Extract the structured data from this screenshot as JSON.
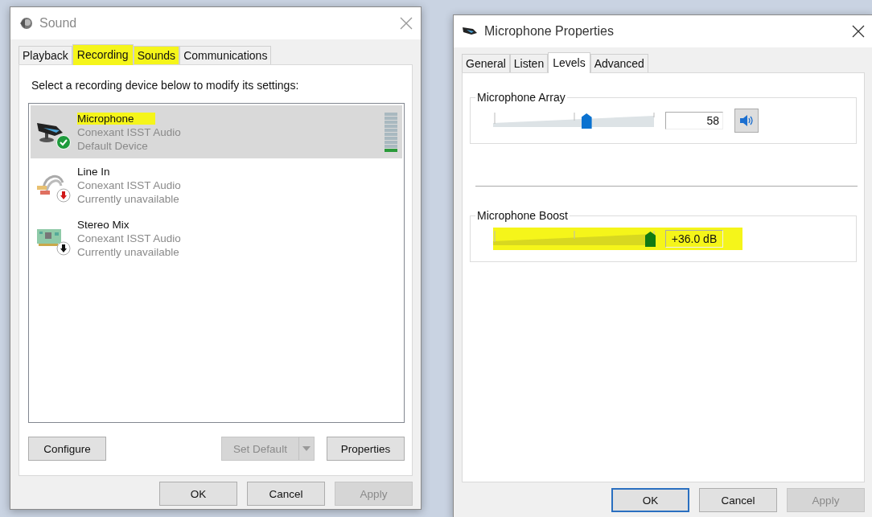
{
  "sound_window": {
    "title": "Sound",
    "tabs": [
      {
        "label": "Playback",
        "selected": false,
        "highlighted": false
      },
      {
        "label": "Recording",
        "selected": true,
        "highlighted": true
      },
      {
        "label": "Sounds",
        "selected": false,
        "highlighted": true
      },
      {
        "label": "Communications",
        "selected": false,
        "highlighted": false
      }
    ],
    "instruction": "Select a recording device below to modify its settings:",
    "devices": [
      {
        "name": "Microphone",
        "driver": "Conexant ISST Audio",
        "status": "Default Device",
        "kind": "microphone",
        "default": true,
        "selected": true,
        "highlighted": true,
        "level": 0.1
      },
      {
        "name": "Line In",
        "driver": "Conexant ISST Audio",
        "status": "Currently unavailable",
        "kind": "line-in",
        "default": false,
        "color": "#d01818",
        "selected": false,
        "highlighted": false
      },
      {
        "name": "Stereo Mix",
        "driver": "Conexant ISST Audio",
        "status": "Currently unavailable",
        "kind": "sound-card",
        "default": false,
        "color": "#111111",
        "selected": false,
        "highlighted": false
      }
    ],
    "buttons": [
      {
        "label": "Configure",
        "kind": "plain",
        "disabled": false
      },
      {
        "label": "Set Default",
        "kind": "split",
        "disabled": true
      },
      {
        "label": "Properties",
        "kind": "plain",
        "disabled": false
      }
    ],
    "footer_buttons": [
      {
        "label": "OK",
        "focused": false,
        "disabled": false
      },
      {
        "label": "Cancel",
        "focused": false,
        "disabled": false
      },
      {
        "label": "Apply",
        "focused": false,
        "disabled": true
      }
    ]
  },
  "properties_window": {
    "title": "Microphone Properties",
    "tabs": [
      {
        "label": "General",
        "selected": false
      },
      {
        "label": "Listen",
        "selected": false
      },
      {
        "label": "Levels",
        "selected": true
      },
      {
        "label": "Advanced",
        "selected": false
      }
    ],
    "groups": [
      {
        "title": "Microphone Array",
        "kind": "volume",
        "level": 0.58,
        "value": "58",
        "highlighted": false
      },
      {
        "title": "Microphone Boost",
        "kind": "boost",
        "level": 1,
        "value": "+36.0 dB",
        "highlighted": true
      }
    ],
    "footer_buttons": [
      {
        "label": "OK",
        "focused": true,
        "disabled": false
      },
      {
        "label": "Cancel",
        "focused": false,
        "disabled": false
      },
      {
        "label": "Apply",
        "focused": false,
        "disabled": true
      }
    ]
  }
}
